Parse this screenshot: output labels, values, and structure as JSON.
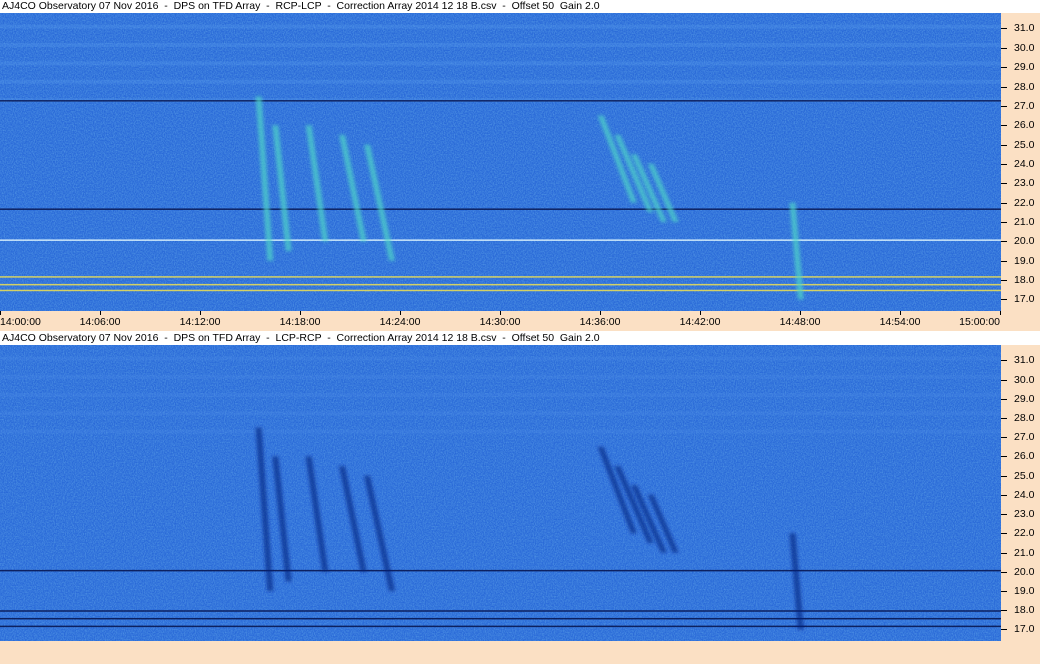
{
  "panels": [
    {
      "title": "AJ4CO Observatory 07 Nov 2016  -  DPS on TFD Array  -  RCP-LCP  -  Correction Array 2014 12 18 B.csv  -  Offset 50  Gain 2.0",
      "polarity": "RCP-LCP"
    },
    {
      "title": "AJ4CO Observatory 07 Nov 2016  -  DPS on TFD Array  -  LCP-RCP  -  Correction Array 2014 12 18 B.csv  -  Offset 50  Gain 2.0",
      "polarity": "LCP-RCP"
    }
  ],
  "y_ticks": [
    "31.0",
    "30.0",
    "29.0",
    "28.0",
    "27.0",
    "26.0",
    "25.0",
    "24.0",
    "23.0",
    "22.0",
    "21.0",
    "20.0",
    "19.0",
    "18.0",
    "17.0"
  ],
  "x_ticks": [
    "14:00:00",
    "14:06:00",
    "14:12:00",
    "14:18:00",
    "14:24:00",
    "14:30:00",
    "14:36:00",
    "14:42:00",
    "14:48:00",
    "14:54:00",
    "15:00:00"
  ],
  "colors": {
    "background": "#2a6ad8",
    "axis_panel": "#fbe0c4",
    "bright_emission": "#4fd6c8",
    "dark_emission": "#0a1a7a"
  },
  "chart_data": [
    {
      "type": "heatmap",
      "title": "AJ4CO Observatory 07 Nov 2016  -  DPS on TFD Array  -  RCP-LCP  -  Correction Array 2014 12 18 B.csv  -  Offset 50  Gain 2.0",
      "x_range": [
        "14:00:00",
        "15:00:00"
      ],
      "y_range": [
        16.4,
        31.8
      ],
      "y_unit": "MHz",
      "emission": "bright",
      "events": [
        {
          "time": "14:15:30",
          "f_top": 27.5,
          "f_bottom": 19.0,
          "drift_min": 0.7
        },
        {
          "time": "14:16:30",
          "f_top": 26.0,
          "f_bottom": 19.5,
          "drift_min": 0.8
        },
        {
          "time": "14:18:30",
          "f_top": 26.0,
          "f_bottom": 20.0,
          "drift_min": 1.0
        },
        {
          "time": "14:20:30",
          "f_top": 25.5,
          "f_bottom": 20.0,
          "drift_min": 1.3
        },
        {
          "time": "14:22:00",
          "f_top": 25.0,
          "f_bottom": 19.0,
          "drift_min": 1.5
        },
        {
          "time": "14:36:00",
          "f_top": 26.5,
          "f_bottom": 22.0,
          "drift_min": 2.0
        },
        {
          "time": "14:37:00",
          "f_top": 25.5,
          "f_bottom": 21.5,
          "drift_min": 2.0
        },
        {
          "time": "14:38:00",
          "f_top": 24.5,
          "f_bottom": 21.0,
          "drift_min": 1.8
        },
        {
          "time": "14:39:00",
          "f_top": 24.0,
          "f_bottom": 21.0,
          "drift_min": 1.5
        },
        {
          "time": "14:47:30",
          "f_top": 22.0,
          "f_bottom": 17.0,
          "drift_min": 0.5
        }
      ],
      "horizontal_lines_mhz": [
        27.3,
        21.7,
        20.1,
        18.2,
        17.8,
        17.5
      ]
    },
    {
      "type": "heatmap",
      "title": "AJ4CO Observatory 07 Nov 2016  -  DPS on TFD Array  -  LCP-RCP  -  Correction Array 2014 12 18 B.csv  -  Offset 50  Gain 2.0",
      "x_range": [
        "14:00:00",
        "15:00:00"
      ],
      "y_range": [
        16.4,
        31.8
      ],
      "y_unit": "MHz",
      "emission": "dark",
      "events": [
        {
          "time": "14:15:30",
          "f_top": 27.5,
          "f_bottom": 19.0,
          "drift_min": 0.7
        },
        {
          "time": "14:16:30",
          "f_top": 26.0,
          "f_bottom": 19.5,
          "drift_min": 0.8
        },
        {
          "time": "14:18:30",
          "f_top": 26.0,
          "f_bottom": 20.0,
          "drift_min": 1.0
        },
        {
          "time": "14:20:30",
          "f_top": 25.5,
          "f_bottom": 20.0,
          "drift_min": 1.3
        },
        {
          "time": "14:22:00",
          "f_top": 25.0,
          "f_bottom": 19.0,
          "drift_min": 1.5
        },
        {
          "time": "14:36:00",
          "f_top": 26.5,
          "f_bottom": 22.0,
          "drift_min": 2.0
        },
        {
          "time": "14:37:00",
          "f_top": 25.5,
          "f_bottom": 21.5,
          "drift_min": 2.0
        },
        {
          "time": "14:38:00",
          "f_top": 24.5,
          "f_bottom": 21.0,
          "drift_min": 1.8
        },
        {
          "time": "14:39:00",
          "f_top": 24.0,
          "f_bottom": 21.0,
          "drift_min": 1.5
        },
        {
          "time": "14:47:30",
          "f_top": 22.0,
          "f_bottom": 17.0,
          "drift_min": 0.5
        }
      ],
      "horizontal_lines_mhz": [
        20.1,
        18.0,
        17.6,
        17.2
      ]
    }
  ]
}
